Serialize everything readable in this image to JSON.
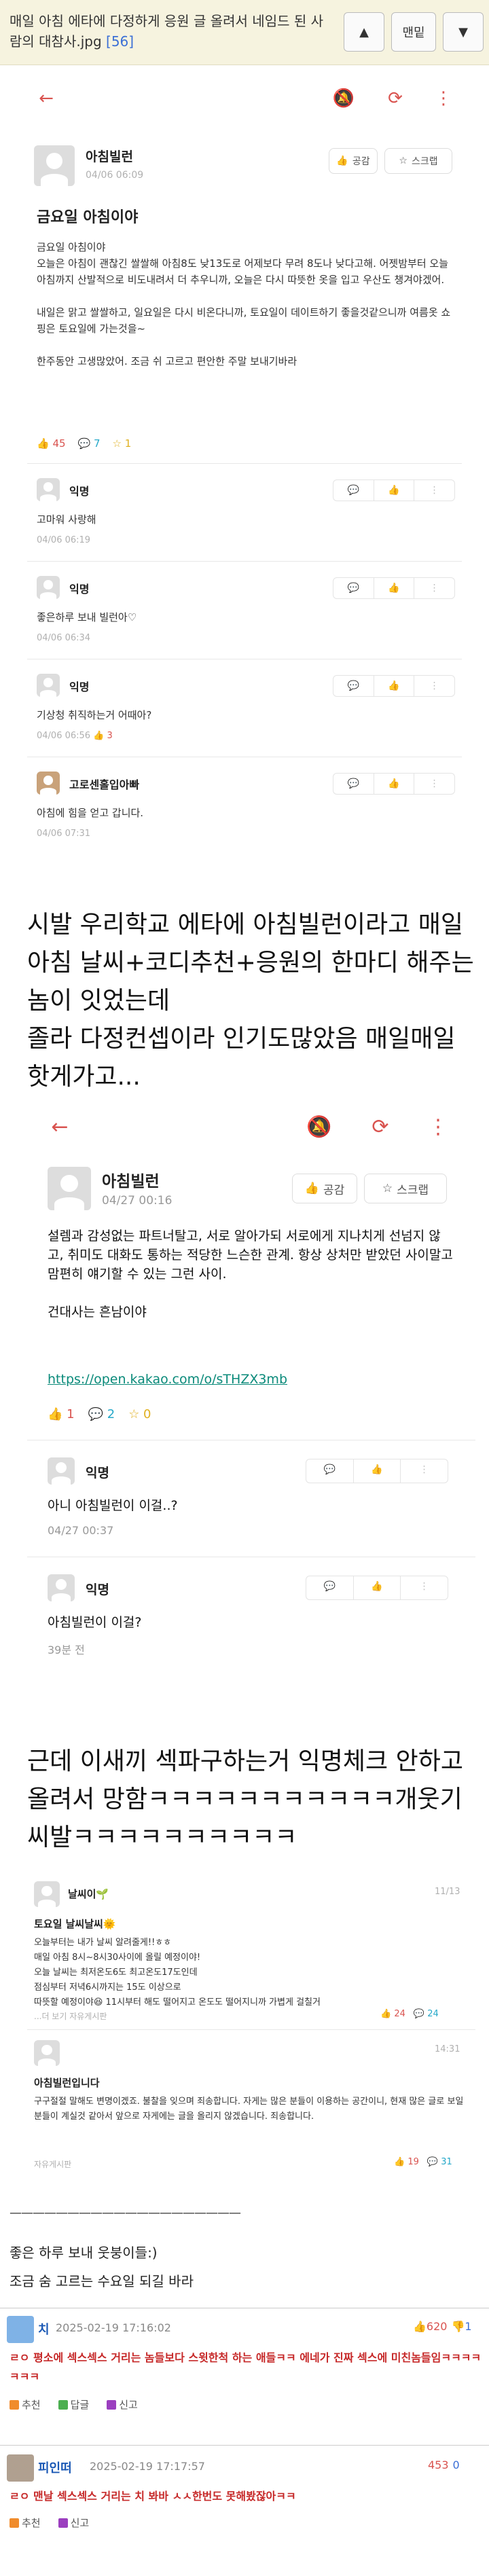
{
  "header": {
    "title": "매일 아침 에타에 다정하게 응원 글 올려서 네임드 된 사람의 대참사.jpg",
    "comment_count": "[56]",
    "up_icon": "up-triangle-icon",
    "latest_label": "맨밑",
    "down_icon": "down-triangle-icon"
  },
  "shot1": {
    "post": {
      "author": "아침빌런",
      "date": "04/06 06:09",
      "like_label": "공감",
      "scrap_label": "스크랩",
      "title": "금요일 아침이야",
      "body": "금요일 아침이야\n오늘은 아침이 괜찮긴 쌀쌀해 아침8도 낮13도로 어제보다 무려 8도나 낮다고해. 어젯밤부터 오늘 아침까지 산발적으로 비도내려서 더 추우니까, 오늘은 다시 따뜻한 옷을 입고 우산도 챙겨야겠어.\n\n내일은 맑고 쌀쌀하고, 일요일은 다시 비온다니까, 토요일이 데이트하기 좋을것같으니까 여름옷 쇼핑은 토요일에 가는것을~\n\n한주동안 고생많았어. 조금 쉬 고르고 편안한 주말 보내기바라",
      "likes": "45",
      "comments": "7",
      "scraps": "1"
    },
    "comments": [
      {
        "author": "익명",
        "body": "고마워 사랑해",
        "date": "04/06 06:19"
      },
      {
        "author": "익명",
        "body": "좋은하루 보내 빌런아♡",
        "date": "04/06 06:34"
      },
      {
        "author": "익명",
        "body": "기상청 취직하는거 어때아?",
        "date": "04/06 06:56",
        "likes": "3"
      },
      {
        "author": "고로센홀입아빠",
        "body": "아침에 힘을 얻고 갑니다.",
        "date": "04/06 07:31"
      }
    ]
  },
  "caption1": "시발 우리학교 에타에 아침빌런이라고 매일 아침 날씨+코디추천+응원의 한마디 해주는 놈이 잇었는데\n졸라 다정컨셉이라 인기도많았음 매일매일 핫게가고...",
  "shot2": {
    "post": {
      "author": "아침빌런",
      "date": "04/27 00:16",
      "like_label": "공감",
      "scrap_label": "스크랩",
      "body": "설렘과 감성없는 파트너탈고, 서로 알아가되 서로에게 지나치게 선넘지 않고, 취미도 대화도 통하는 적당한 느슨한 관계. 항상 상처만 받았던 사이말고 맘편히 얘기할 수 있는 그런 사이.\n\n건대사는 흔남이야",
      "link": "https://open.kakao.com/o/sTHZX3mb",
      "likes": "1",
      "comments": "2",
      "scraps": "0"
    },
    "comments": [
      {
        "author": "익명",
        "body": "아니 아침빌런이 이걸..?",
        "date": "04/27 00:37"
      },
      {
        "author": "익명",
        "body": "아침빌런이 이걸?",
        "date": "39분 전"
      }
    ]
  },
  "caption2": "근데 이새끼 섹파구하는거 익명체크 안하고 올려서 망함ㅋㅋㅋㅋㅋㅋㅋㅋㅋㅋㅋ개웃기    씨발ㅋㅋㅋㅋㅋㅋㅋㅋㅋㅋ",
  "shot3": {
    "posts": [
      {
        "author": "날씨이🌱",
        "time": "11/13",
        "title": "토요일 날씨날씨🌞",
        "body": "오늘부터는 내가 날씨 알려줄게!!ㅎㅎ\n매일 아침 8시~8시30사이에 올릴 예정이야!\n오늘 날씨는 최저온도6도 최고온도17도인데\n점심부터 저녁6시까지는 15도 이상으로\n따뜻할 예정이야😆 11시부터 해도 떨어지고 온도도 떨어지니까 가볍게 걸칠거",
        "more": "...더 보기",
        "footer": "자유게시판",
        "likes": "24",
        "comments": "24"
      },
      {
        "author": "아침빌런",
        "time": "14:31",
        "title": "아침빌런입니다",
        "body": "구구절절 말해도 변명이겠죠. 불찰을 잊으며 죄송합니다. 자게는 많은 분들이 이용하는 공간이니, 현재 많은 글로 보일분들이 계실것 같아서 앞으로 자게에는 글을 올리지 않겠습니다. 죄송합니다.",
        "footer": "자유게시판",
        "likes": "19",
        "comments": "31"
      }
    ]
  },
  "dashes": "————————————————————",
  "caption3": "좋은 하루 보내 웃붕이들:)\n조금 숨 고르는 수요일 되길 바라",
  "site_comments": [
    {
      "author": "치",
      "date": "2025-02-19 17:16:02",
      "up": "620",
      "down": "1",
      "body": "ㄹㅇ 평소에 섹스섹스 거리는 놈들보다 스윗한척 하는 애들ㅋㅋ 에네가 진짜 섹스에 미친놈들임ㅋㅋㅋㅋㅋㅋㅋ",
      "actions": [
        "추천",
        "답글",
        "신고"
      ]
    },
    {
      "author": "피인떠",
      "date": "2025-02-19 17:17:57",
      "up": "453",
      "down": "0",
      "body": "ㄹㅇ 맨날 섹스섹스 거리는 치 봐바 ㅅㅅ한번도 못해봤잖아ㅋㅋ",
      "actions": [
        "추천",
        "신고"
      ]
    }
  ],
  "colors": {
    "accent_red": "#d9534f",
    "link_teal": "#0a8a7a",
    "comment_red": "#c62828",
    "name_blue": "#1a58b5"
  }
}
